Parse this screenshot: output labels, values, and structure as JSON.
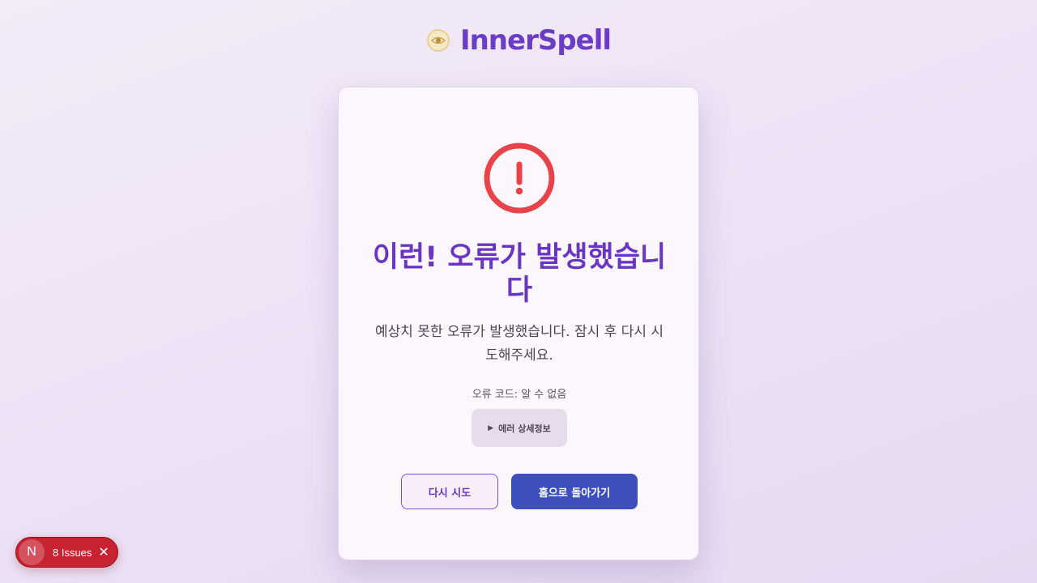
{
  "brand": {
    "name": "InnerSpell",
    "icon": "eye-sun-icon"
  },
  "error": {
    "icon": "exclamation-circle-icon",
    "title": "이런! 오류가 발생했습니다",
    "description": "예상치 못한 오류가 발생했습니다. 잠시 후 다시 시도해주세요.",
    "code": "오류 코드: 알 수 없음",
    "details_label": "에러 상세정보"
  },
  "actions": {
    "retry_label": "다시 시도",
    "home_label": "홈으로 돌아가기"
  },
  "dev_badge": {
    "logo": "N",
    "label": "8 Issues"
  },
  "colors": {
    "accent": "#6a35c2",
    "error": "#e8434a",
    "primary_button": "#3d4fbd",
    "issues_badge": "#c82331"
  }
}
